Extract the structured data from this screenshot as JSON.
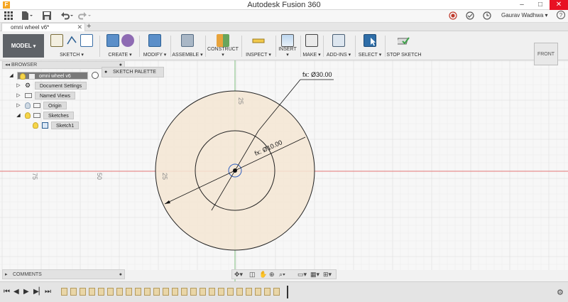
{
  "window": {
    "title": "Autodesk Fusion 360",
    "minimize": "–",
    "maximize": "□",
    "close": "✕"
  },
  "qat": {
    "user_name": "Gaurav Wadhwa ▾",
    "help": "?"
  },
  "document_tab": {
    "label": "omni wheel v6*",
    "close": "✕",
    "new_tab": "+"
  },
  "workspace": {
    "label": "MODEL"
  },
  "ribbon": {
    "groups": [
      {
        "id": "sketch",
        "label": "SKETCH ▾"
      },
      {
        "id": "create",
        "label": "CREATE ▾"
      },
      {
        "id": "modify",
        "label": "MODIFY ▾"
      },
      {
        "id": "assemble",
        "label": "ASSEMBLE ▾"
      },
      {
        "id": "construct",
        "label": "CONSTRUCT ▾"
      },
      {
        "id": "inspect",
        "label": "INSPECT ▾"
      },
      {
        "id": "insert",
        "label": "INSERT ▾"
      },
      {
        "id": "make",
        "label": "MAKE ▾"
      },
      {
        "id": "addins",
        "label": "ADD-INS ▾"
      },
      {
        "id": "select",
        "label": "SELECT ▾"
      },
      {
        "id": "stopsketch",
        "label": "STOP SKETCH"
      }
    ]
  },
  "browser": {
    "title": "BROWSER",
    "root": "omni wheel v6",
    "items": [
      {
        "label": "Document Settings"
      },
      {
        "label": "Named Views"
      },
      {
        "label": "Origin"
      },
      {
        "label": "Sketches"
      },
      {
        "label": "Sketch1"
      }
    ]
  },
  "sketch_palette": {
    "label": "SKETCH PALETTE"
  },
  "viewcube": {
    "label": "FRONT"
  },
  "canvas": {
    "dim_outer": "fx: Ø30.00",
    "dim_inner": "fx: Ø10.00",
    "axis_labels": [
      "75",
      "50",
      "25",
      "25"
    ]
  },
  "comments": {
    "title": "COMMENTS"
  },
  "colors": {
    "sketch_fill": "#f5e6d3",
    "x_axis": "#e05050",
    "y_axis": "#60b060",
    "selected_tool": "#2f6ea8"
  }
}
